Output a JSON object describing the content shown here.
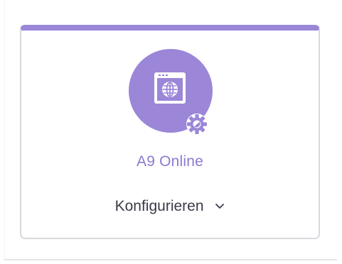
{
  "card": {
    "title": "A9 Online",
    "action_label": "Konfigurieren",
    "accent_color": "#9b86d8",
    "icon": "browser-globe-icon",
    "badge_icon": "gear-icon",
    "action_icon": "chevron-down-icon"
  }
}
